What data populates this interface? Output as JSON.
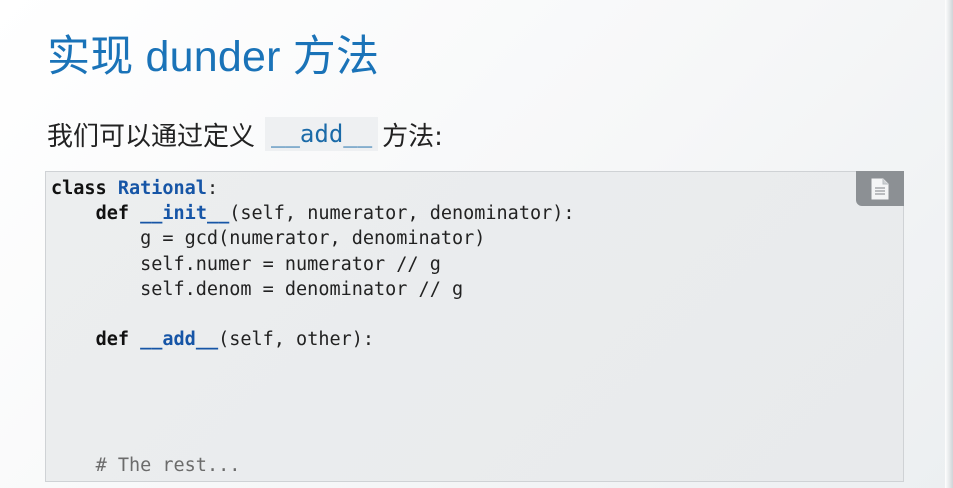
{
  "slide": {
    "title": "实现 dunder 方法",
    "subtitle": {
      "before": "我们可以通过定义",
      "code": "__add__",
      "after": "方法:"
    }
  },
  "code_block": {
    "copy_button_icon": "copy-document-icon",
    "lines": [
      {
        "indent": "",
        "kw": "class ",
        "name": "Rational",
        "rest": ":"
      },
      {
        "indent": "    ",
        "kw": "def ",
        "name": "__init__",
        "rest": "(self, numerator, denominator):"
      },
      {
        "indent": "        ",
        "text": "g = gcd(numerator, denominator)"
      },
      {
        "indent": "        ",
        "text": "self.numer = numerator // g"
      },
      {
        "indent": "        ",
        "text": "self.denom = denominator // g"
      },
      {
        "indent": "",
        "text": ""
      },
      {
        "indent": "    ",
        "kw": "def ",
        "name": "__add__",
        "rest": "(self, other):"
      },
      {
        "indent": "",
        "text": ""
      },
      {
        "indent": "",
        "text": ""
      },
      {
        "indent": "",
        "text": ""
      },
      {
        "indent": "",
        "text": ""
      },
      {
        "indent": "    ",
        "comment": "# The rest..."
      }
    ]
  },
  "colors": {
    "title": "#1a73b8",
    "code_name": "#1655a6",
    "inline_code": "#1a6aa8",
    "comment": "#6b6b6b"
  }
}
